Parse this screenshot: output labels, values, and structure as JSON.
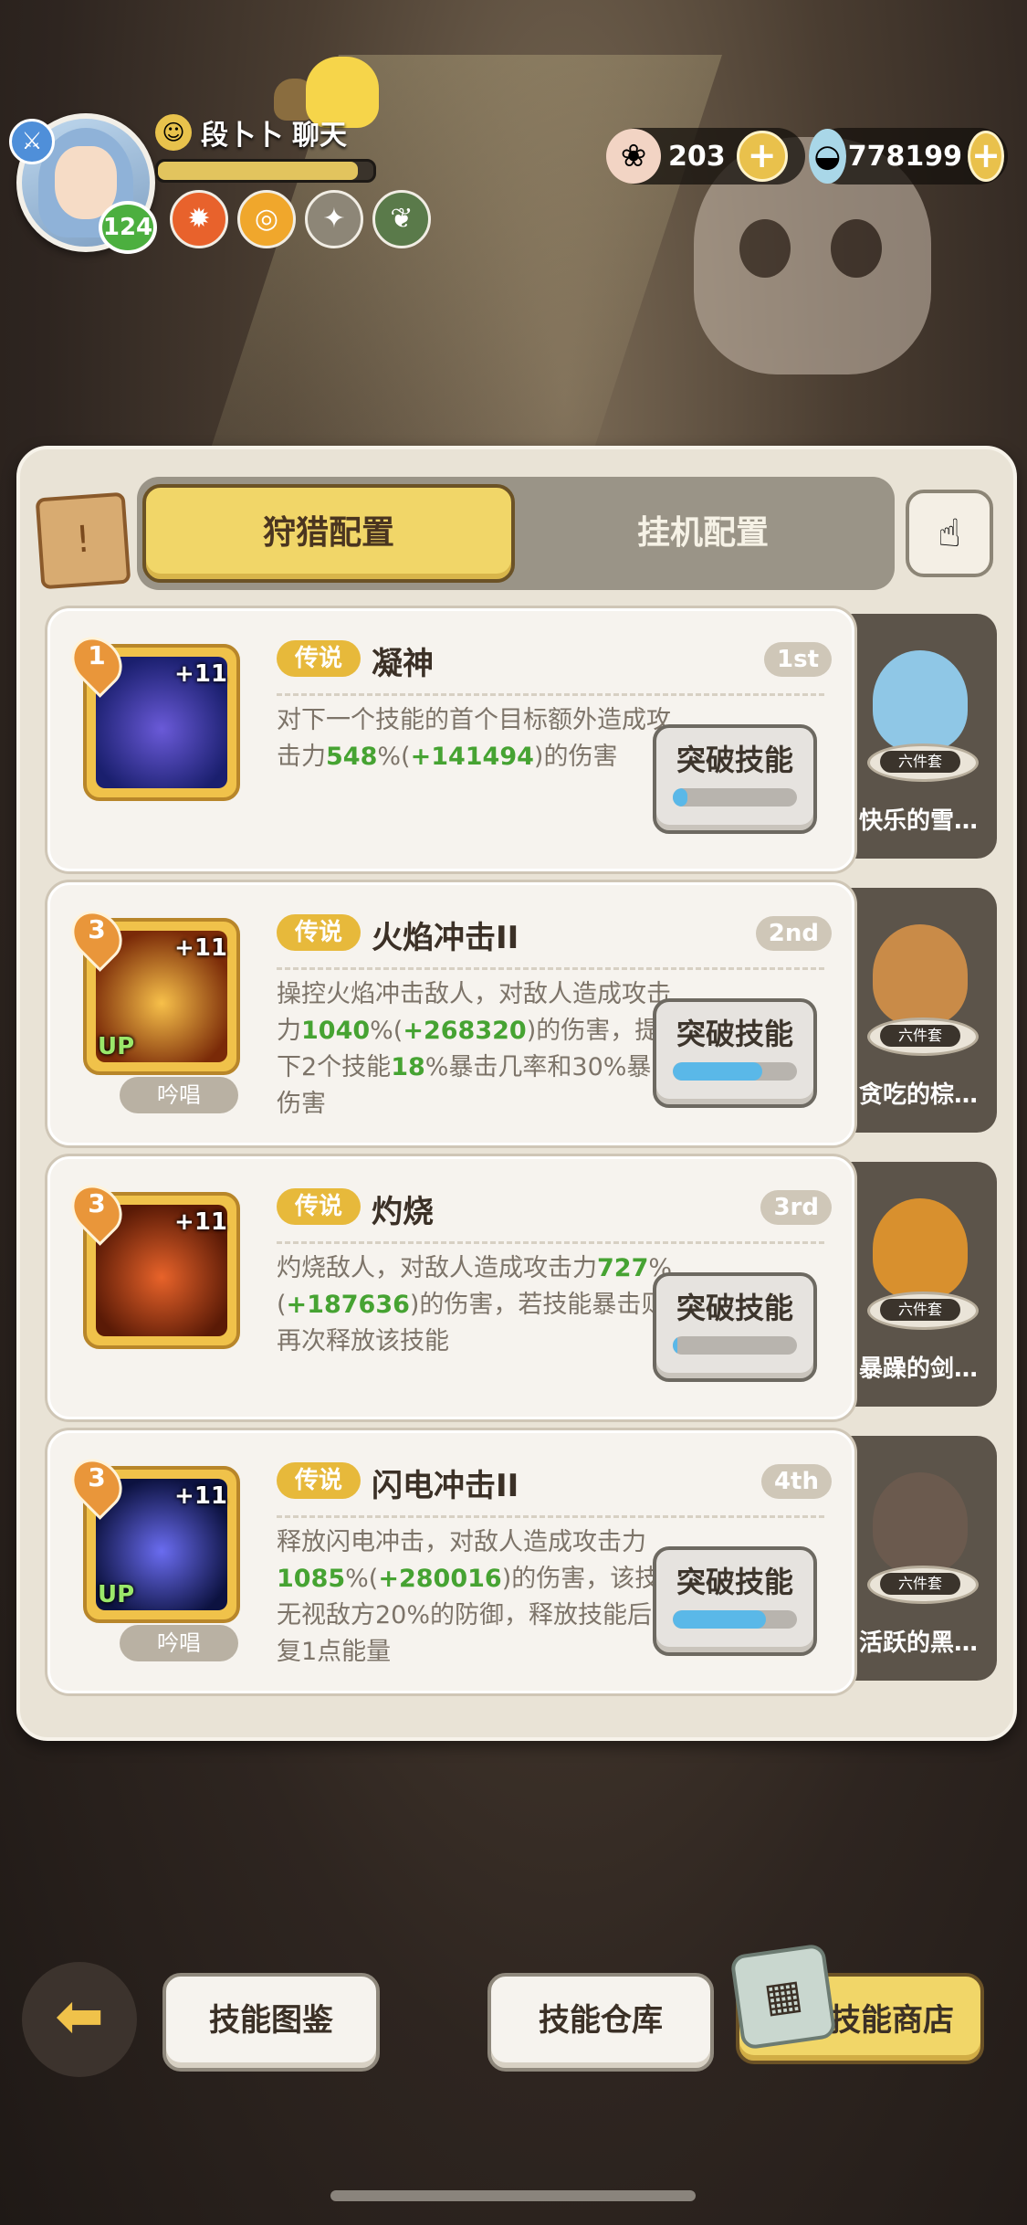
{
  "header": {
    "player_level": "124",
    "player_name": "段卜卜",
    "chat_label": "聊天",
    "xp_fraction": 0.93,
    "buffs": [
      "fire-buff-icon",
      "spiral-buff-icon",
      "shield-buff-icon",
      "leaf-buff-icon"
    ],
    "currencies": [
      {
        "icon": "seashell-icon",
        "value": "203"
      },
      {
        "icon": "clam-icon",
        "value": "778199"
      }
    ]
  },
  "tabs": [
    {
      "label": "狩猎配置",
      "active": true
    },
    {
      "label": "挂机配置",
      "active": false
    }
  ],
  "skills": [
    {
      "order": "1",
      "rank": "1st",
      "rarity": "传说",
      "name": "凝神",
      "plus": "+11",
      "up": "",
      "chant": "",
      "desc_parts": [
        "对下一个技能的首个目标额外造成攻击力",
        "548",
        "%(",
        "+141494",
        ")的伤害"
      ],
      "break_label": "突破技能",
      "break_progress": 0.12,
      "set_tag": "六件套",
      "set_name": "快乐的雪…",
      "art_colors": [
        "#1a1f6e",
        "#6a5ad8"
      ],
      "set_color": "#8fc7e6"
    },
    {
      "order": "3",
      "rank": "2nd",
      "rarity": "传说",
      "name": "火焰冲击II",
      "plus": "+11",
      "up": "UP",
      "chant": "吟唱",
      "desc_parts": [
        "操控火焰冲击敌人，对敌人造成攻击力",
        "1040",
        "%(",
        "+268320",
        ")的伤害，提升下2个技能",
        "18",
        "%暴击几率和30%暴击伤害"
      ],
      "break_label": "突破技能",
      "break_progress": 0.72,
      "set_tag": "六件套",
      "set_name": "贪吃的棕…",
      "art_colors": [
        "#7a2a08",
        "#f7c04a"
      ],
      "set_color": "#c98b48"
    },
    {
      "order": "3",
      "rank": "3rd",
      "rarity": "传说",
      "name": "灼烧",
      "plus": "+11",
      "up": "",
      "chant": "",
      "desc_parts": [
        "灼烧敌人，对敌人造成攻击力",
        "727",
        "%(",
        "+187636",
        ")的伤害，若技能暴击则再次释放该技能"
      ],
      "break_label": "突破技能",
      "break_progress": 0.03,
      "set_tag": "六件套",
      "set_name": "暴躁的剑…",
      "art_colors": [
        "#5a1a06",
        "#e8632a"
      ],
      "set_color": "#d8902e"
    },
    {
      "order": "3",
      "rank": "4th",
      "rarity": "传说",
      "name": "闪电冲击II",
      "plus": "+11",
      "up": "UP",
      "chant": "吟唱",
      "desc_parts": [
        "释放闪电冲击，对敌人造成攻击力",
        "1085",
        "%(",
        "+280016",
        ")的伤害，该技能无视敌方20%的防御，释放技能后回复1点能量"
      ],
      "break_label": "突破技能",
      "break_progress": 0.75,
      "set_tag": "六件套",
      "set_name": "活跃的黑…",
      "art_colors": [
        "#0c1240",
        "#6a6cf0"
      ],
      "set_color": "#6b5a4e"
    }
  ],
  "bottom": {
    "codex_label": "技能图鉴",
    "storage_label": "技能仓库",
    "shop_label": "技能商店"
  },
  "colors": {
    "accent_yellow": "#f1d668",
    "highlight_green": "#46a332",
    "progress_blue": "#5ab8e8"
  }
}
